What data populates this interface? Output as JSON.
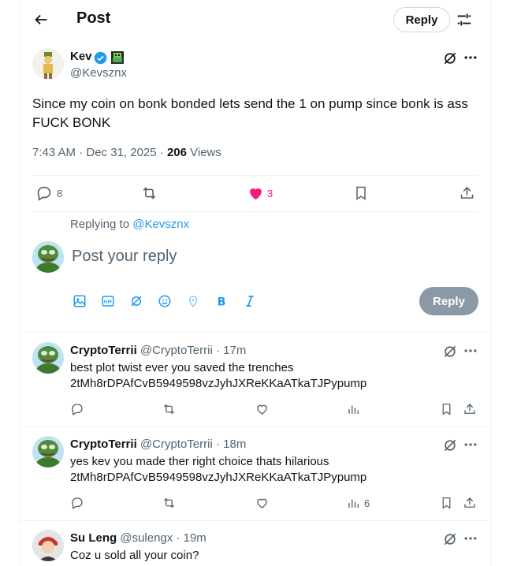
{
  "header": {
    "title": "Post",
    "reply_label": "Reply"
  },
  "tweet": {
    "author": {
      "name": "Kev",
      "handle": "@Kevsznx"
    },
    "text": "Since my coin on bonk bonded lets send the 1 on pump since bonk is ass\nFUCK BONK",
    "time": "7:43 AM · Dec 31, 2025 · ",
    "views_count": "206",
    "views_label": " Views",
    "stats": {
      "replies": "8",
      "likes": "3"
    }
  },
  "composer": {
    "replying_to_prefix": "Replying to ",
    "replying_to_handle": "@Kevsznx",
    "placeholder": "Post your reply",
    "reply_label": "Reply"
  },
  "replies": [
    {
      "name": "CryptoTerrii",
      "handle_time": " @CryptoTerrii · 17m",
      "text": "best plot twist ever you saved the trenches\n2tMh8rDPAfCvB5949598vzJyhJXReKKaATkaTJPypump",
      "views": ""
    },
    {
      "name": "CryptoTerrii",
      "handle_time": " @CryptoTerrii · 18m",
      "text": "yes kev you made ther right choice thats hilarious\n2tMh8rDPAfCvB5949598vzJyhJXReKKaATkaTJPypump",
      "views": "6"
    },
    {
      "name": "Su Leng",
      "handle_time": " @sulengx · 19m",
      "text": "Coz u sold all your coin?",
      "views": ""
    }
  ],
  "colors": {
    "accent": "#1d9bf0",
    "like": "#f91880",
    "muted": "#536471",
    "disabled_button": "#8b98a5"
  }
}
